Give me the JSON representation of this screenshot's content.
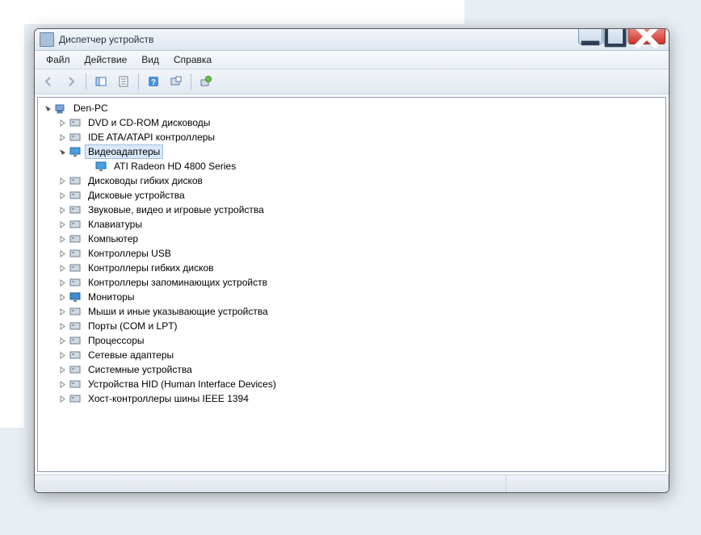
{
  "window": {
    "title": "Диспетчер устройств"
  },
  "menu": {
    "file": "Файл",
    "action": "Действие",
    "view": "Вид",
    "help": "Справка"
  },
  "tree": {
    "root": "Den-PC",
    "items": [
      {
        "label": "DVD и CD-ROM дисководы",
        "icon": "disc"
      },
      {
        "label": "IDE ATA/ATAPI контроллеры",
        "icon": "ide"
      },
      {
        "label": "Видеоадаптеры",
        "icon": "display",
        "selected": true,
        "expanded": true,
        "children": [
          {
            "label": "ATI Radeon HD 4800 Series",
            "icon": "display"
          }
        ]
      },
      {
        "label": "Дисководы гибких дисков",
        "icon": "floppy"
      },
      {
        "label": "Дисковые устройства",
        "icon": "disk"
      },
      {
        "label": "Звуковые, видео и игровые устройства",
        "icon": "sound"
      },
      {
        "label": "Клавиатуры",
        "icon": "keyboard"
      },
      {
        "label": "Компьютер",
        "icon": "computer"
      },
      {
        "label": "Контроллеры USB",
        "icon": "usb"
      },
      {
        "label": "Контроллеры гибких дисков",
        "icon": "floppy"
      },
      {
        "label": "Контроллеры запоминающих устройств",
        "icon": "storage"
      },
      {
        "label": "Мониторы",
        "icon": "monitor"
      },
      {
        "label": "Мыши и иные указывающие устройства",
        "icon": "mouse"
      },
      {
        "label": "Порты (COM и LPT)",
        "icon": "port"
      },
      {
        "label": "Процессоры",
        "icon": "cpu"
      },
      {
        "label": "Сетевые адаптеры",
        "icon": "network"
      },
      {
        "label": "Системные устройства",
        "icon": "system"
      },
      {
        "label": "Устройства HID (Human Interface Devices)",
        "icon": "hid"
      },
      {
        "label": "Хост-контроллеры шины IEEE 1394",
        "icon": "firewire"
      }
    ]
  }
}
